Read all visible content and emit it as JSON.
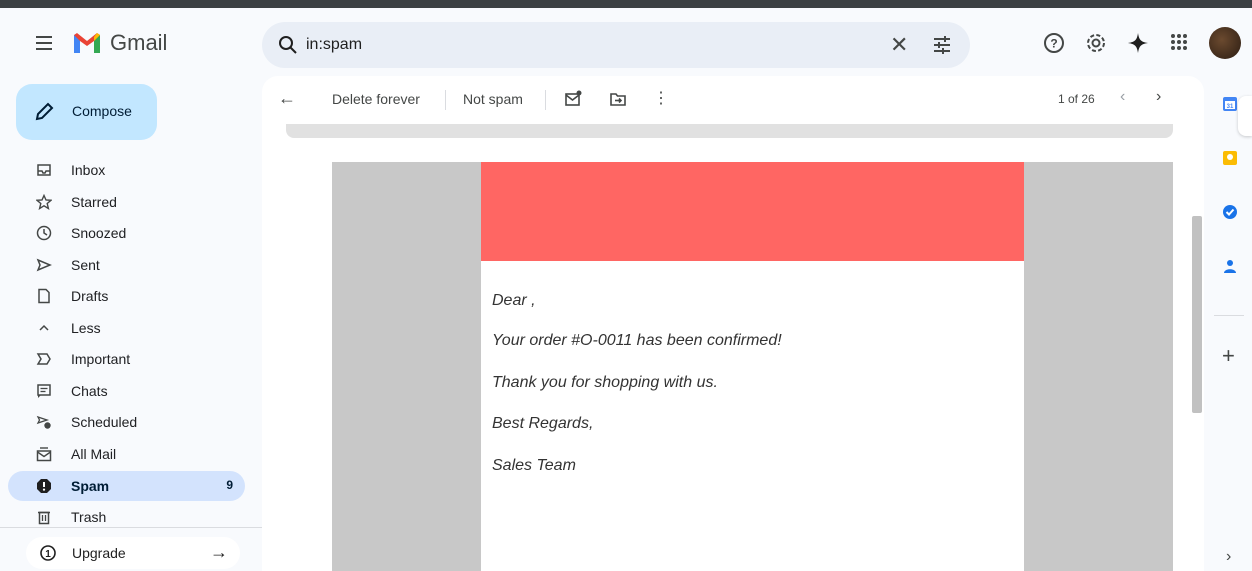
{
  "app": {
    "name": "Gmail"
  },
  "search": {
    "query": "in:spam"
  },
  "compose": {
    "label": "Compose"
  },
  "sidebar": {
    "items": [
      {
        "label": "Inbox",
        "icon": "inbox-icon"
      },
      {
        "label": "Starred",
        "icon": "star-icon"
      },
      {
        "label": "Snoozed",
        "icon": "clock-icon"
      },
      {
        "label": "Sent",
        "icon": "send-icon"
      },
      {
        "label": "Drafts",
        "icon": "draft-icon"
      },
      {
        "label": "Less",
        "icon": "chevron-up-icon"
      },
      {
        "label": "Important",
        "icon": "important-icon"
      },
      {
        "label": "Chats",
        "icon": "chat-icon"
      },
      {
        "label": "Scheduled",
        "icon": "scheduled-icon"
      },
      {
        "label": "All Mail",
        "icon": "all-mail-icon"
      },
      {
        "label": "Spam",
        "icon": "spam-icon",
        "count": "9",
        "active": true
      },
      {
        "label": "Trash",
        "icon": "trash-icon"
      }
    ],
    "upgrade": "Upgrade"
  },
  "toolbar": {
    "delete_forever": "Delete forever",
    "not_spam": "Not spam",
    "pager": "1 of 26"
  },
  "email": {
    "lines": [
      "Dear ,",
      "Your order #O-0011 has been confirmed!",
      "Thank you for shopping with us.",
      "Best Regards,",
      "Sales Team"
    ],
    "header_color": "#ff6663"
  },
  "colors": {
    "compose_bg": "#c2e7ff",
    "active_nav": "#d3e3fd",
    "search_bg": "#e9eef6"
  }
}
